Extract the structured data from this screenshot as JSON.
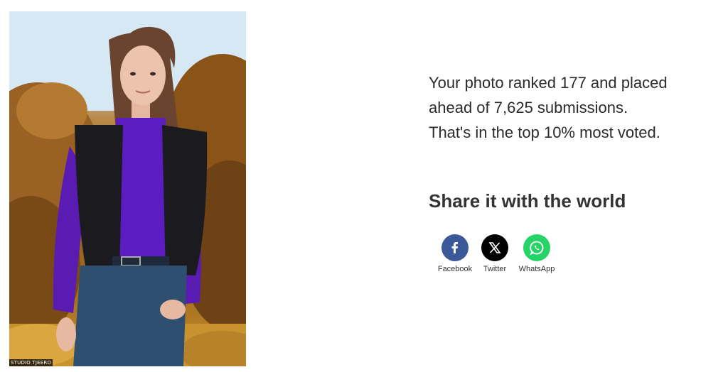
{
  "photo": {
    "alt": "Portrait of a girl in a purple turtleneck and black vest outdoors",
    "watermark": "STUDIO TJEERD"
  },
  "result": {
    "line1": "Your photo ranked 177 and placed",
    "line2": "ahead of 7,625 submissions.",
    "line3": "That's in the top 10% most voted."
  },
  "share": {
    "heading": "Share it with the world",
    "buttons": [
      {
        "label": "Facebook",
        "icon": "facebook-icon",
        "color": "#3b5998"
      },
      {
        "label": "Twitter",
        "icon": "x-icon",
        "color": "#000000"
      },
      {
        "label": "WhatsApp",
        "icon": "whatsapp-icon",
        "color": "#25d366"
      }
    ]
  }
}
